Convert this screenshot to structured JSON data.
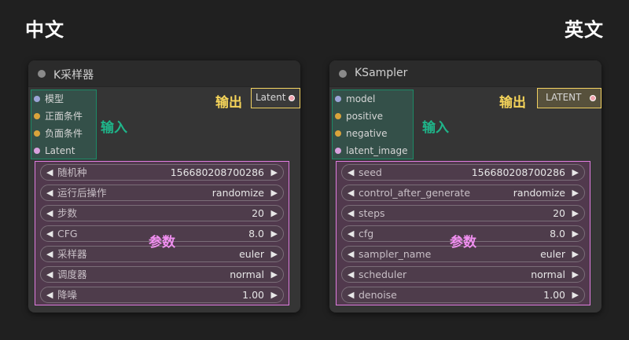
{
  "headings": {
    "left": "中文",
    "right": "英文"
  },
  "nodes": [
    {
      "title": "K采样器",
      "inputs": [
        {
          "name": "模型",
          "color": "#9ba4d6"
        },
        {
          "name": "正面条件",
          "color": "#d9a33b"
        },
        {
          "name": "负面条件",
          "color": "#d9a33b"
        },
        {
          "name": "Latent",
          "color": "#d8a0dd"
        }
      ],
      "inputs_label": "输入",
      "output": {
        "name": "Latent"
      },
      "outputs_label": "输出",
      "params_label": "参数",
      "widgets": [
        {
          "name": "随机种",
          "value": "156680208700286"
        },
        {
          "name": "运行后操作",
          "value": "randomize"
        },
        {
          "name": "步数",
          "value": "20"
        },
        {
          "name": "CFG",
          "value": "8.0"
        },
        {
          "name": "采样器",
          "value": "euler"
        },
        {
          "name": "调度器",
          "value": "normal"
        },
        {
          "name": "降噪",
          "value": "1.00"
        }
      ]
    },
    {
      "title": "KSampler",
      "inputs": [
        {
          "name": "model",
          "color": "#9ba4d6"
        },
        {
          "name": "positive",
          "color": "#d9a33b"
        },
        {
          "name": "negative",
          "color": "#d9a33b"
        },
        {
          "name": "latent_image",
          "color": "#d8a0dd"
        }
      ],
      "inputs_label": "输入",
      "output": {
        "name": "LATENT"
      },
      "outputs_label": "输出",
      "params_label": "参数",
      "widgets": [
        {
          "name": "seed",
          "value": "156680208700286"
        },
        {
          "name": "control_after_generate",
          "value": "randomize"
        },
        {
          "name": "steps",
          "value": "20"
        },
        {
          "name": "cfg",
          "value": "8.0"
        },
        {
          "name": "sampler_name",
          "value": "euler"
        },
        {
          "name": "scheduler",
          "value": "normal"
        },
        {
          "name": "denoise",
          "value": "1.00"
        }
      ]
    }
  ],
  "icons": {
    "left_arrow": "◀",
    "right_arrow": "▶"
  }
}
